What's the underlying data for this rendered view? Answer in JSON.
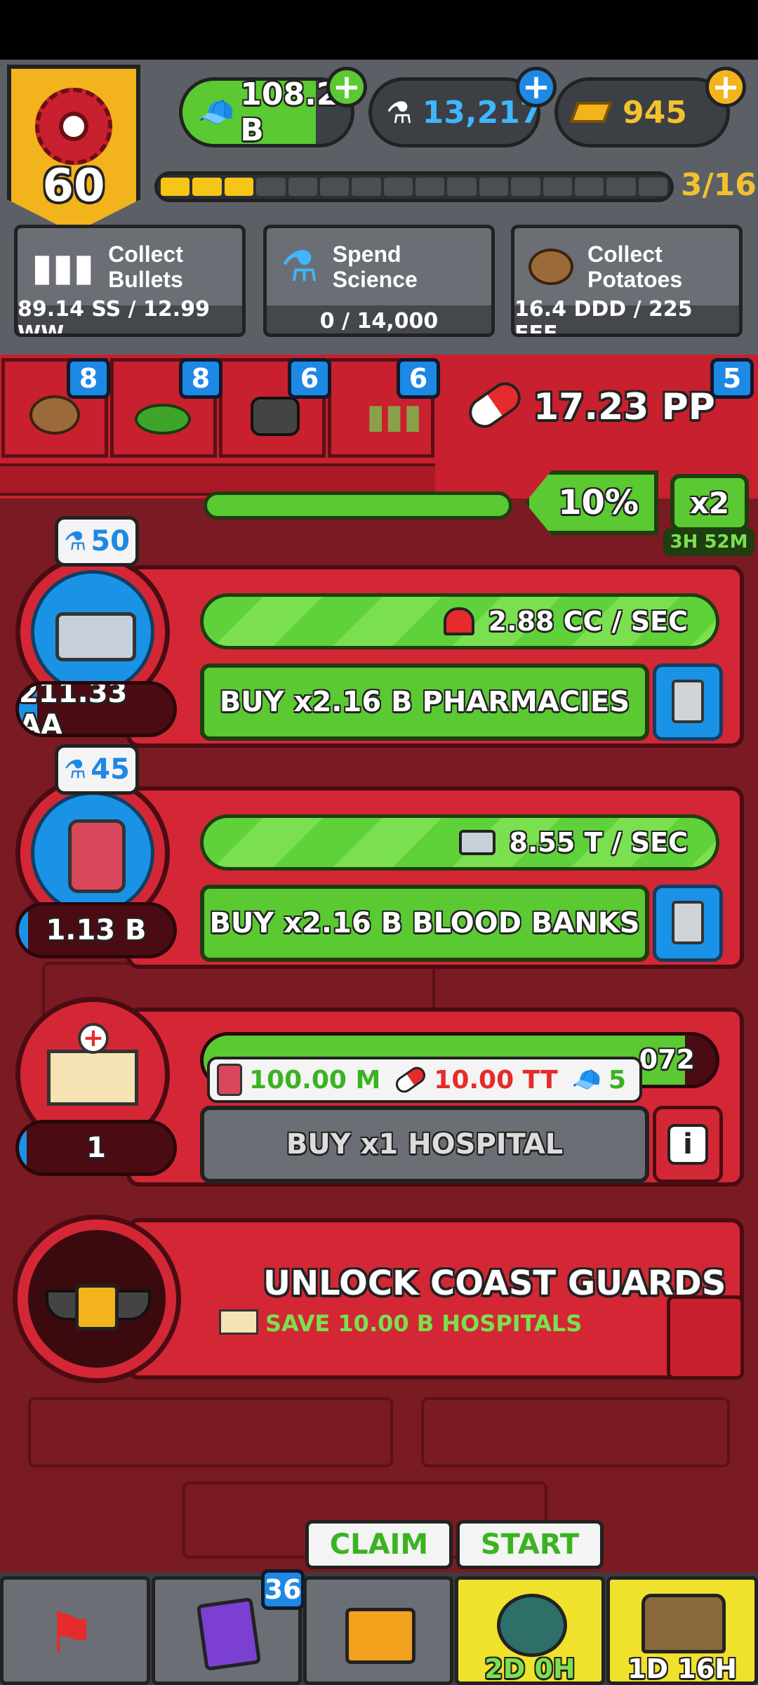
{
  "player": {
    "level": "60"
  },
  "currencies": [
    {
      "name": "cash",
      "value": "108.29 B"
    },
    {
      "name": "science",
      "value": "13,217"
    },
    {
      "name": "gold",
      "value": "945"
    }
  ],
  "progress": {
    "text": "3/16",
    "filled": 3,
    "total": 16
  },
  "tasks": [
    {
      "line1": "Collect",
      "line2": "Bullets",
      "progress": "89.14 SS / 12.99 WW"
    },
    {
      "line1": "Spend",
      "line2": "Science",
      "progress": "0 / 14,000"
    },
    {
      "line1": "Collect",
      "line2": "Potatoes",
      "progress": "16.4 DDD / 225 EEE"
    }
  ],
  "resource_tabs": [
    {
      "icon": "potato-icon",
      "badge": "8"
    },
    {
      "icon": "flag-swamp-icon",
      "badge": "8"
    },
    {
      "icon": "coal-icon",
      "badge": "6"
    },
    {
      "icon": "bullets-icon",
      "badge": "6"
    }
  ],
  "pills": {
    "value": "17.23 PP",
    "badge": "5"
  },
  "boost": {
    "percent": "10%",
    "multiplier": "x2",
    "timer": "3H 52M"
  },
  "industries": [
    {
      "cost": "50",
      "rate": "2.88 CC / SEC",
      "buy_label": "BUY x2.16 B PHARMACIES",
      "count": "211.33 AA",
      "fill": 0.12
    },
    {
      "cost": "45",
      "rate": "8.55 T / SEC",
      "buy_label": "BUY x2.16 B BLOOD BANKS",
      "count": "1.13 B",
      "fill": 0.06
    },
    {
      "rate_partial": "072",
      "price_a": "100.00 M",
      "price_b": "10.00 TT",
      "price_c": "5",
      "buy_label": "BUY x1 HOSPITAL",
      "count": "1",
      "fill": 0.05
    }
  ],
  "locked": {
    "title": "UNLOCK COAST GUARDS",
    "subtitle": "SAVE 10.00 B HOSPITALS"
  },
  "nav": {
    "cards_badge": "36",
    "claim_label": "CLAIM",
    "start_label": "START",
    "timer_a": "2D 0H",
    "timer_b": "1D 16H"
  },
  "colors": {
    "accent_green": "#5ac932",
    "red": "#d42736",
    "blue": "#1a93e6",
    "gold": "#f2b31d"
  }
}
